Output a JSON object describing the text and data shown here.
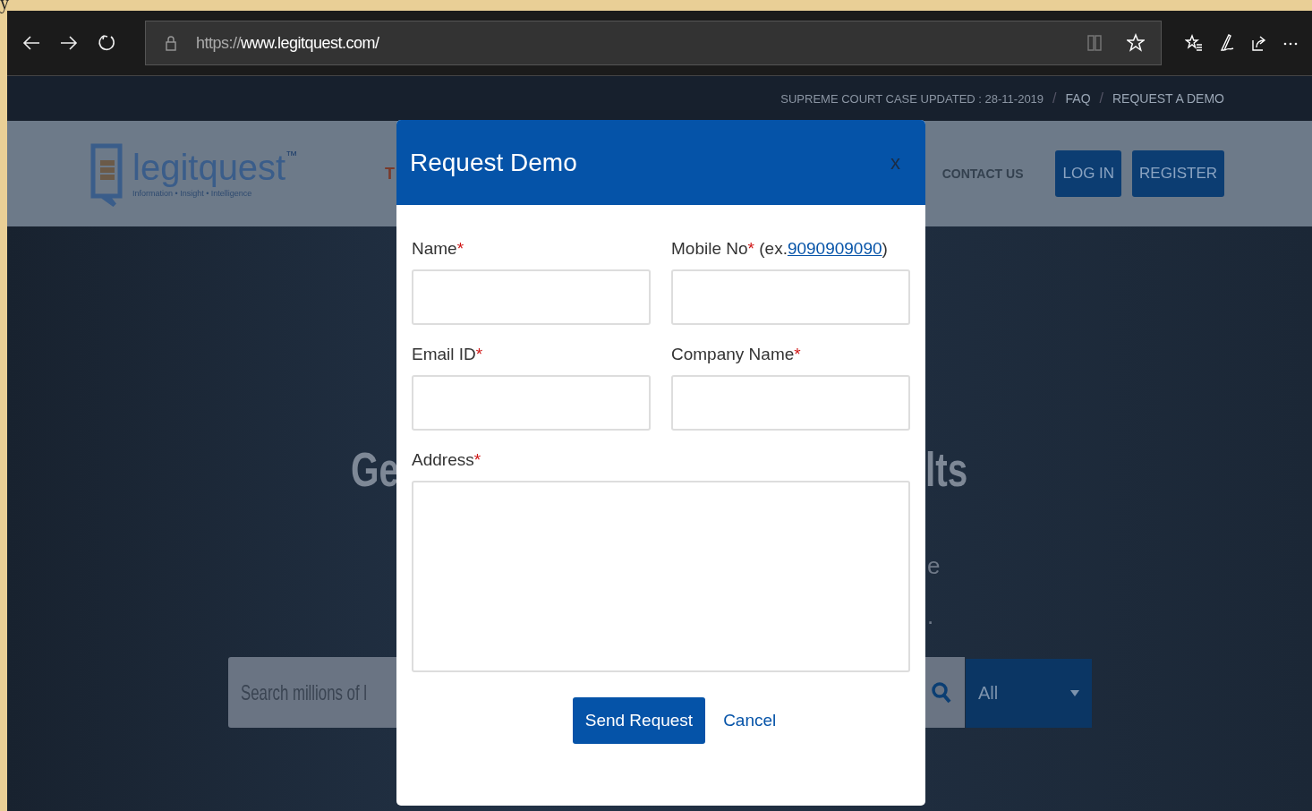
{
  "border_text": "y",
  "browser": {
    "url_scheme": "https://",
    "url_host": "www.legitquest.com/"
  },
  "top_bar": {
    "items": [
      {
        "text": "SUPREME COURT CASE UPDATED : 28-11-2019",
        "kind": "notice"
      },
      {
        "text": "FAQ",
        "kind": "link"
      },
      {
        "text": "REQUEST A DEMO",
        "kind": "link"
      }
    ],
    "separators": [
      "/",
      "/"
    ]
  },
  "header": {
    "logo": {
      "name": "legitquest",
      "trademark": "™",
      "tagline": "Information • Insight • Intelligence"
    },
    "nav": [
      "T",
      "CONTACT US"
    ],
    "buttons": [
      "LOG IN",
      "REGISTER"
    ]
  },
  "hero": {
    "title_left": "Ge",
    "title_right": "lts",
    "lines": [
      {
        "right": "e"
      },
      {
        "right": "."
      }
    ],
    "search_placeholder": "Search millions of l",
    "filter": "All"
  },
  "modal": {
    "title": "Request Demo",
    "close": "x",
    "fields": [
      {
        "kind": "input",
        "label": "Name",
        "mark": "*"
      },
      {
        "kind": "input",
        "label": "Mobile No",
        "mark": "*",
        "hint_prefix": "(ex.",
        "hint_link": "9090909090",
        "hint_suffix": ")"
      },
      {
        "kind": "input",
        "label": "Email ID",
        "mark": "*"
      },
      {
        "kind": "input",
        "label": "Company Name",
        "mark": "*"
      },
      {
        "kind": "textarea",
        "label": "Address",
        "mark": "*"
      }
    ],
    "submit": "Send Request",
    "cancel": "Cancel"
  }
}
